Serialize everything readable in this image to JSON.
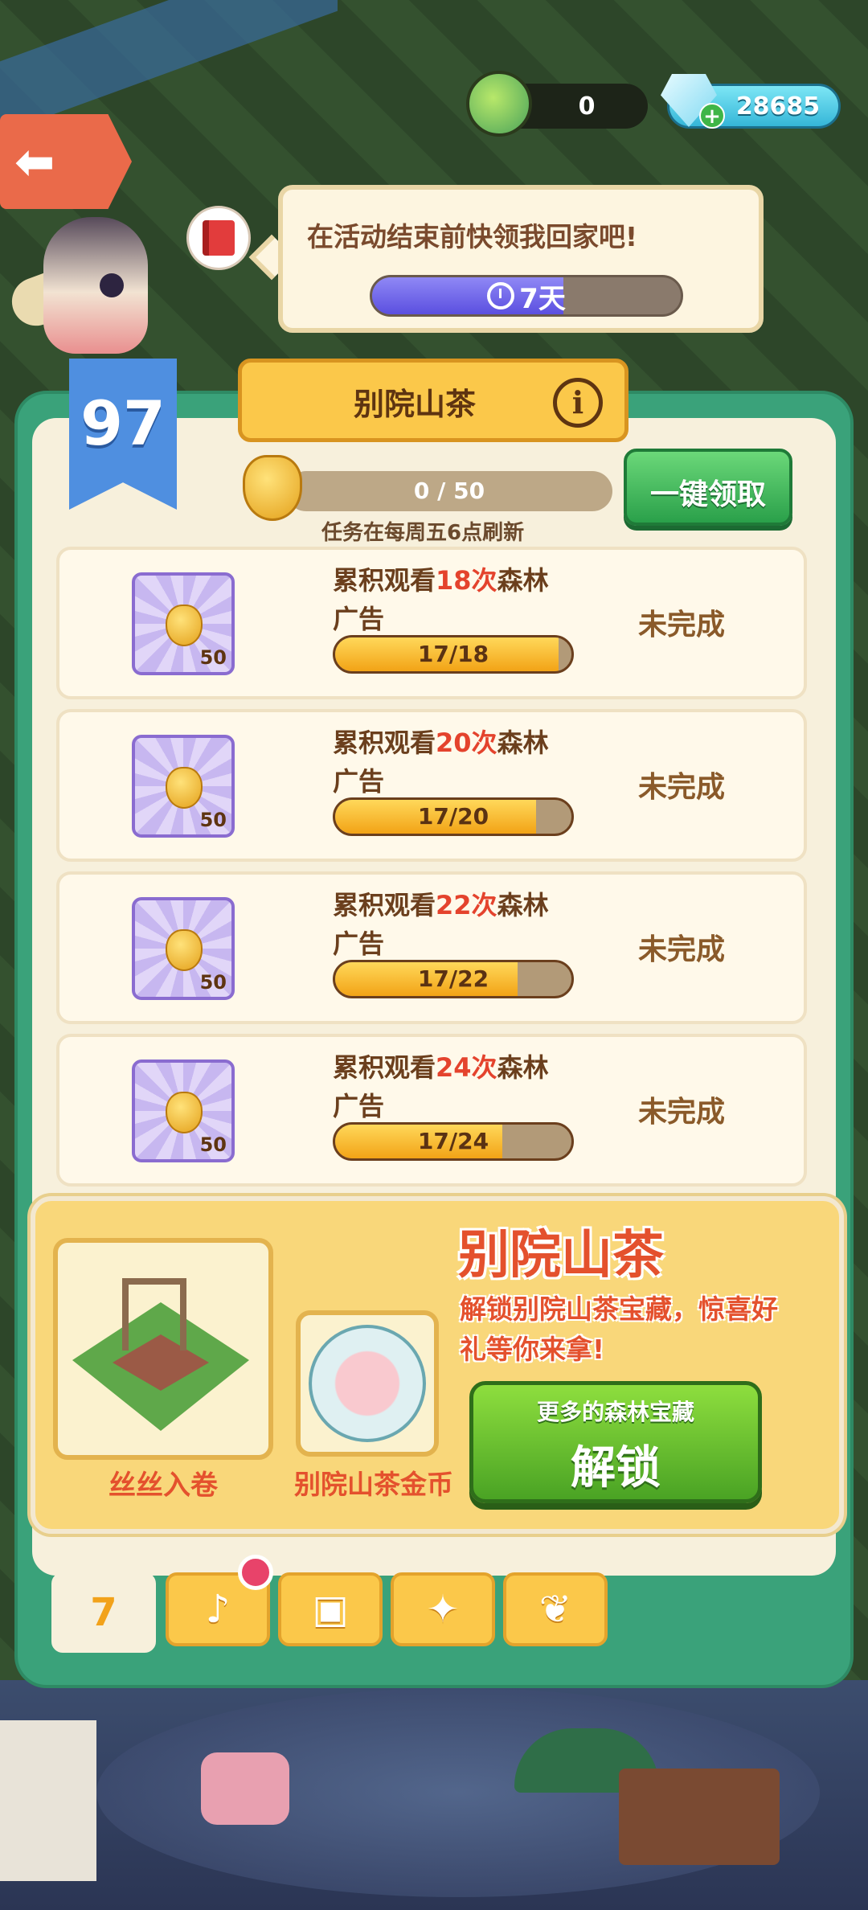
{
  "currencies": {
    "leaf": {
      "value": "0",
      "icon": "leaf-sprite-icon"
    },
    "gem": {
      "value": "28685",
      "icon": "diamond-icon",
      "plus": "+"
    }
  },
  "back_button": {
    "icon": "back-arrow-icon",
    "glyph": "⬅"
  },
  "speech": {
    "text": "在活动结束前快领我回家吧!",
    "timer": "7天",
    "timer_icon": "clock-icon",
    "progress": 0.62
  },
  "level": "97",
  "panel": {
    "title": "别院山茶",
    "info_glyph": "i",
    "progress_text": "0 / 50",
    "progress": 0,
    "refresh_note": "任务在每周五6点刷新",
    "claim_all_label": "一键领取"
  },
  "tasks": [
    {
      "pre": "累积观看",
      "count": "18次",
      "post": "森林广告",
      "reward_qty": "50",
      "progress_text": "17/18",
      "progress": 0.944,
      "status": "未完成"
    },
    {
      "pre": "累积观看",
      "count": "20次",
      "post": "森林广告",
      "reward_qty": "50",
      "progress_text": "17/20",
      "progress": 0.85,
      "status": "未完成"
    },
    {
      "pre": "累积观看",
      "count": "22次",
      "post": "森林广告",
      "reward_qty": "50",
      "progress_text": "17/22",
      "progress": 0.773,
      "status": "未完成"
    },
    {
      "pre": "累积观看",
      "count": "24次",
      "post": "森林广告",
      "reward_qty": "50",
      "progress_text": "17/24",
      "progress": 0.708,
      "status": "未完成"
    }
  ],
  "promo": {
    "title": "别院山茶",
    "description": "解锁别院山茶宝藏，惊喜好礼等你来拿!",
    "item1_label": "丝丝入卷",
    "item2_label": "别院山茶金币",
    "unlock_sub": "更多的森林宝藏",
    "unlock_main": "解锁"
  },
  "tabs": [
    {
      "name": "calendar",
      "glyph": "7",
      "active": true
    },
    {
      "name": "bell",
      "glyph": "♪",
      "active": false
    },
    {
      "name": "tickets",
      "glyph": "▣",
      "active": false
    },
    {
      "name": "gift",
      "glyph": "✦",
      "active": false
    },
    {
      "name": "leaf",
      "glyph": "❦",
      "active": false
    }
  ]
}
